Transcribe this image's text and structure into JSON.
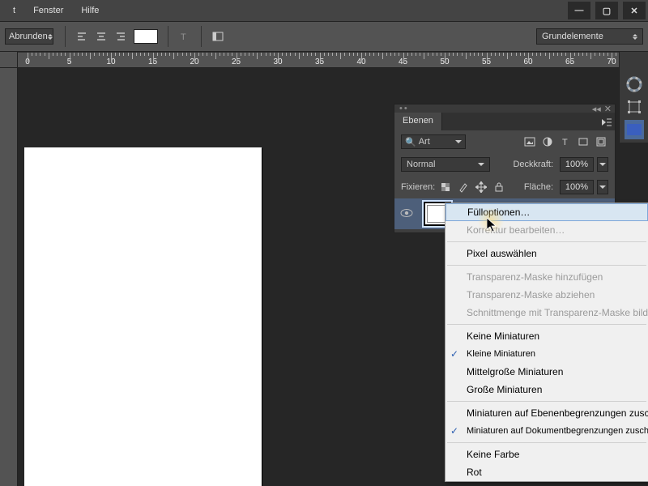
{
  "menu": {
    "fenster": "Fenster",
    "hilfe": "Hilfe"
  },
  "win": {
    "min": "—",
    "max": "▢",
    "close": "✕"
  },
  "optbar": {
    "round": "Abrunden",
    "grund": "Grundelemente"
  },
  "ruler": {
    "ticks": [
      0,
      5,
      10,
      15,
      20,
      25,
      30,
      35,
      40,
      45,
      50,
      55,
      60,
      65,
      70
    ]
  },
  "panel": {
    "title": "Ebenen",
    "filter": "Art",
    "blend": "Normal",
    "opacity_label": "Deckkraft:",
    "opacity_val": "100%",
    "lock_label": "Fixieren:",
    "fill_label": "Fläche:",
    "fill_val": "100%"
  },
  "ctx": {
    "fill_options": "Fülloptionen…",
    "adjust_edit": "Korrektur bearbeiten…",
    "select_px": "Pixel auswählen",
    "add_mask": "Transparenz-Maske hinzufügen",
    "sub_mask": "Transparenz-Maske abziehen",
    "intersect_mask": "Schnittmenge mit Transparenz-Maske bilden",
    "thumb_none": "Keine Miniaturen",
    "thumb_small": "Kleine Miniaturen",
    "thumb_medium": "Mittelgroße Miniaturen",
    "thumb_large": "Große Miniaturen",
    "thumb_clip_layer": "Miniaturen auf Ebenenbegrenzungen zuschneiden",
    "thumb_clip_doc": "Miniaturen auf Dokumentbegrenzungen zuschneiden",
    "color_none": "Keine Farbe",
    "color_red": "Rot"
  }
}
